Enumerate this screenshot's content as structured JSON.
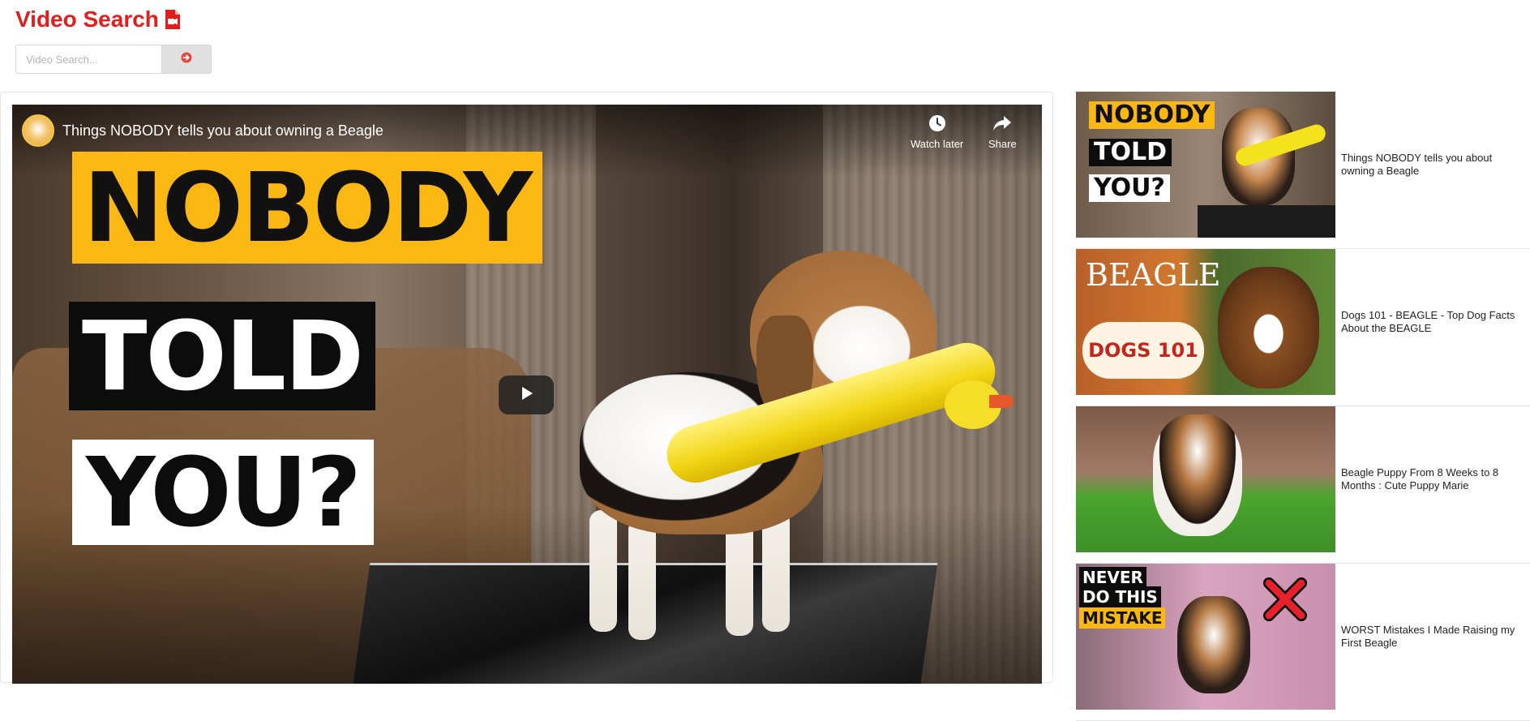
{
  "app": {
    "title": "Video Search",
    "title_icon": "video-file-icon",
    "accent_color": "#e01e1e"
  },
  "search": {
    "placeholder": "Video Search...",
    "value": "",
    "submit_icon": "arrow-circle-right-icon"
  },
  "player": {
    "channel_avatar": "beagle-avatar",
    "title": "Things NOBODY tells you about owning a Beagle",
    "actions": [
      {
        "label": "Watch later",
        "icon": "clock-icon"
      },
      {
        "label": "Share",
        "icon": "share-arrow-icon"
      }
    ],
    "thumbnail_text": [
      "NOBODY",
      "TOLD",
      "YOU?"
    ],
    "play_icon": "play-icon"
  },
  "sidebar": {
    "items": [
      {
        "title": "Things NOBODY tells you about owning a Beagle",
        "thumb_text": [
          "NOBODY",
          "TOLD",
          "YOU?"
        ]
      },
      {
        "title": "Dogs 101 - BEAGLE - Top Dog Facts About the BEAGLE",
        "thumb_text": [
          "BEAGLE",
          "DOGS 101"
        ]
      },
      {
        "title": "Beagle Puppy From 8 Weeks to 8 Months : Cute Puppy Marie",
        "thumb_text": []
      },
      {
        "title": "WORST Mistakes I Made Raising my First Beagle",
        "thumb_text": [
          "NEVER",
          "DO THIS",
          "MISTAKE"
        ]
      }
    ]
  }
}
